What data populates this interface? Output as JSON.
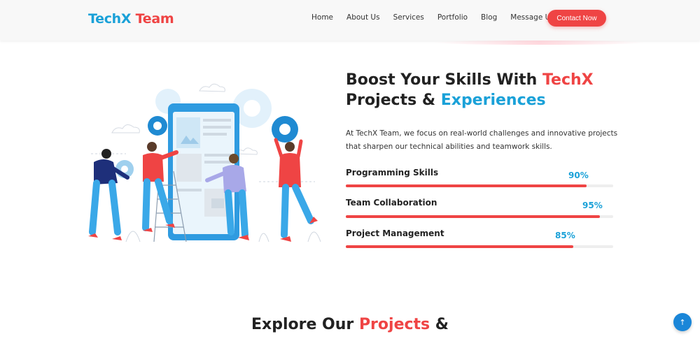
{
  "header": {
    "logo_part1": "TechX",
    "logo_part2": "Team",
    "nav": [
      "Home",
      "About Us",
      "Services",
      "Portfolio",
      "Blog",
      "Message Us"
    ],
    "contact_label": "Contact Now"
  },
  "hero": {
    "title_line1_a": "Boost Your Skills With ",
    "title_line1_b": "TechX",
    "title_line2_a": "Projects & ",
    "title_line2_b": "Experiences",
    "description": "At TechX Team, we focus on real-world challenges and innovative projects that sharpen our technical abilities and teamwork skills.",
    "skills": [
      {
        "name": "Programming Skills",
        "percent_label": "90%",
        "value": 0.9
      },
      {
        "name": "Team Collaboration",
        "percent_label": "95%",
        "value": 0.95
      },
      {
        "name": "Project Management",
        "percent_label": "85%",
        "value": 0.85
      }
    ]
  },
  "section": {
    "title_a": "Explore Our ",
    "title_b": "Projects",
    "title_c": " &"
  },
  "scroll_top_icon": "arrow-up-icon",
  "colors": {
    "brand_blue": "#1aa1d8",
    "brand_red": "#ef4444"
  }
}
